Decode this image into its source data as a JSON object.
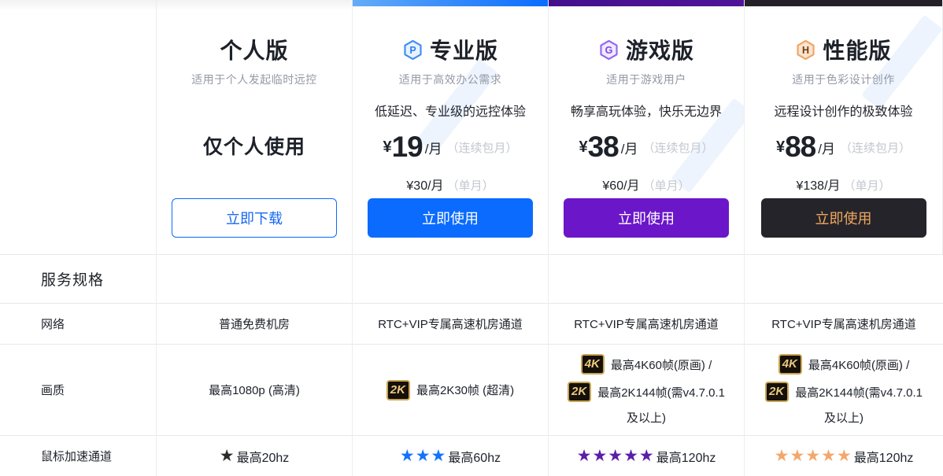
{
  "theme": {
    "accent_blue": "#0a6bfe",
    "bar_blue_start": "#63acf8",
    "bar_purple": "#4f1499",
    "bar_dark": "#232127",
    "btn_purple": "#6b16c9",
    "btn_dark_bg": "#26242b",
    "btn_dark_text": "#f0a85e",
    "badge_gold": "#eac97e",
    "badge_border": "#c9a654",
    "badge_bg": "#15100a",
    "text_dark": "#1d2129",
    "text_gray": "#9399a5",
    "text_light": "#c3c7cf",
    "divider": "#ebedf0"
  },
  "plans": [
    {
      "title": "个人版",
      "subtitle": "适用于个人发起临时远控",
      "highlight": "仅个人使用",
      "button_label": "立即下载"
    },
    {
      "icon_letter": "P",
      "icon_fill": "#e8f2fe",
      "icon_stroke": "#3e8df2",
      "icon_text_color": "#2f7ff0",
      "title": "专业版",
      "subtitle": "适用于高效办公需求",
      "tagline": "低延迟、专业级的远控体验",
      "price_currency": "¥",
      "price_amount": "19",
      "price_unit": "/月",
      "price_note": "（连续包月）",
      "alt_price": "¥30/月",
      "alt_note": "（单月）",
      "button_label": "立即使用"
    },
    {
      "icon_letter": "G",
      "icon_fill": "#f0eafe",
      "icon_stroke": "#9266f0",
      "icon_text_color": "#7b45e6",
      "title": "游戏版",
      "subtitle": "适用于游戏用户",
      "tagline": "畅享高玩体验，快乐无边界",
      "price_currency": "¥",
      "price_amount": "38",
      "price_unit": "/月",
      "price_note": "（连续包月）",
      "alt_price": "¥60/月",
      "alt_note": "（单月）",
      "button_label": "立即使用"
    },
    {
      "icon_letter": "H",
      "icon_fill": "#fbe3cc",
      "icon_stroke": "#f0a467",
      "icon_text_color": "#6b3c12",
      "title": "性能版",
      "subtitle": "适用于色彩设计创作",
      "tagline": "远程设计创作的极致体验",
      "price_currency": "¥",
      "price_amount": "88",
      "price_unit": "/月",
      "price_note": "（连续包月）",
      "alt_price": "¥138/月",
      "alt_note": "（单月）",
      "button_label": "立即使用"
    }
  ],
  "features": {
    "section_title": "服务规格",
    "network": {
      "label": "网络",
      "cells": [
        "普通免费机房",
        "RTC+VIP专属高速机房通道",
        "RTC+VIP专属高速机房通道",
        "RTC+VIP专属高速机房通道"
      ]
    },
    "quality": {
      "label": "画质",
      "c1_text": "最高1080p (高清)",
      "c2_badge": "2K",
      "c2_text": "最高2K30帧 (超清)",
      "c3_line1_badge": "4K",
      "c3_line1_text": "最高4K60帧(原画) /",
      "c3_line2_badge": "2K",
      "c3_line2_text": "最高2K144帧(需v4.7.0.1",
      "c3_line3_text": "及以上)",
      "c4_line1_badge": "4K",
      "c4_line1_text": "最高4K60帧(原画) /",
      "c4_line2_badge": "2K",
      "c4_line2_text": "最高2K144帧(需v4.7.0.1",
      "c4_line3_text": "及以上)"
    },
    "mouse": {
      "label": "鼠标加速通道",
      "cells": [
        {
          "stars": "★",
          "star_color": "#2b2b2b",
          "text": "最高20hz"
        },
        {
          "stars": "★★★",
          "star_color": "#1273fa",
          "text": "最高60hz"
        },
        {
          "stars": "★★★★★",
          "star_color": "#5a1fa8",
          "text": "最高120hz"
        },
        {
          "stars": "★★★★★",
          "star_color": "#f4a76d",
          "text": "最高120hz"
        }
      ]
    }
  }
}
